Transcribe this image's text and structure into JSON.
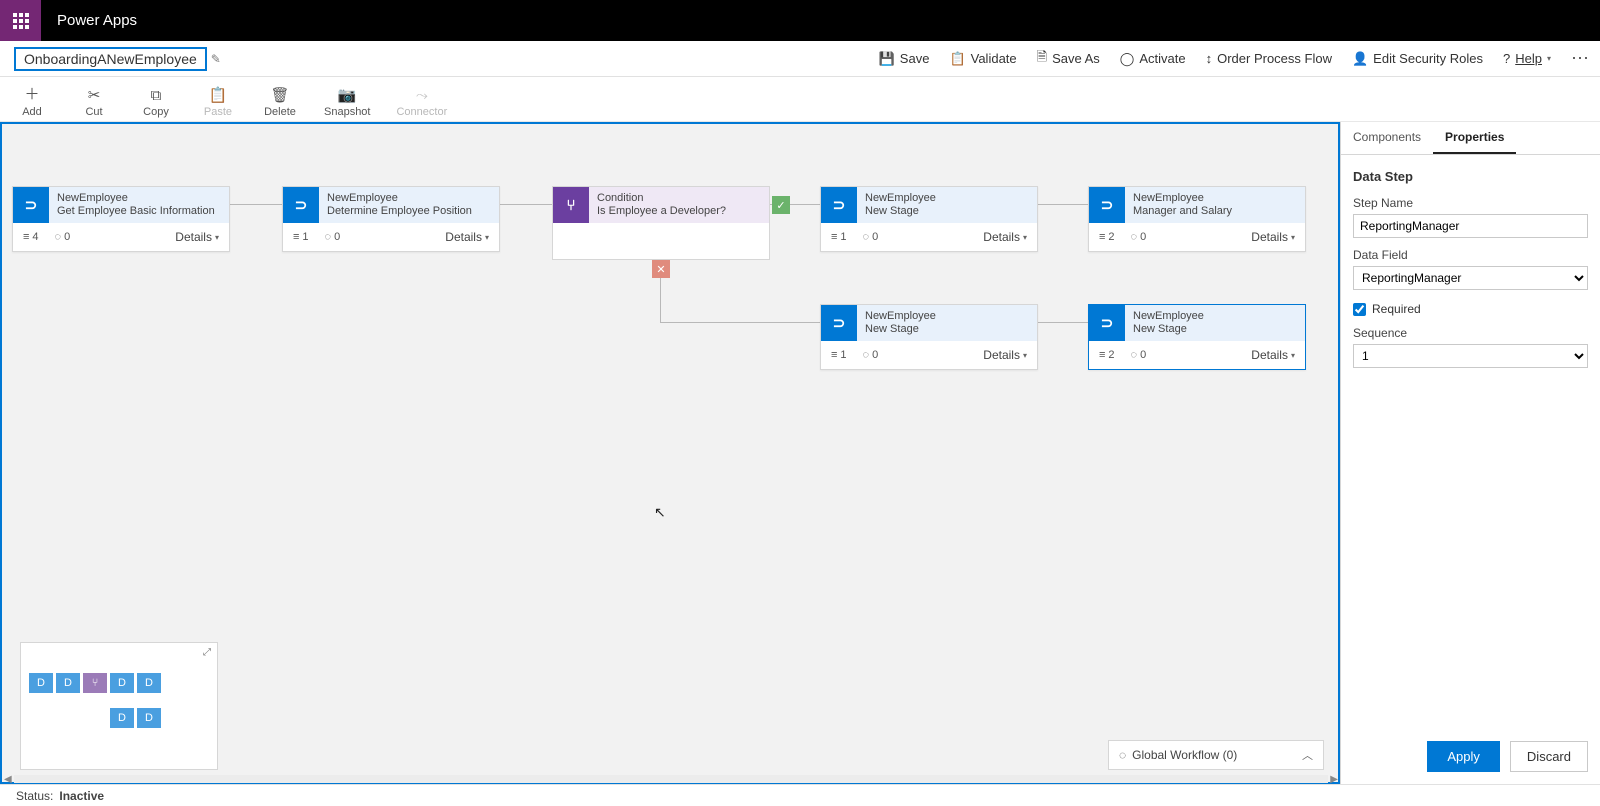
{
  "suite": {
    "title": "Power Apps"
  },
  "formName": "OnboardingANewEmployee",
  "commands": {
    "save": "Save",
    "validate": "Validate",
    "saveAs": "Save As",
    "activate": "Activate",
    "orderProcess": "Order Process Flow",
    "editSecurity": "Edit Security Roles",
    "help": "Help"
  },
  "toolbar": {
    "add": "Add",
    "cut": "Cut",
    "copy": "Copy",
    "paste": "Paste",
    "delete": "Delete",
    "snapshot": "Snapshot",
    "connector": "Connector"
  },
  "nodes": {
    "n1": {
      "title": "NewEmployee",
      "sub": "Get Employee Basic Information",
      "steps": "4",
      "triggers": "0",
      "details": "Details"
    },
    "n2": {
      "title": "NewEmployee",
      "sub": "Determine Employee Position",
      "steps": "1",
      "triggers": "0",
      "details": "Details"
    },
    "cond": {
      "title": "Condition",
      "sub": "Is Employee a Developer?"
    },
    "n3": {
      "title": "NewEmployee",
      "sub": "New Stage",
      "steps": "1",
      "triggers": "0",
      "details": "Details"
    },
    "n4": {
      "title": "NewEmployee",
      "sub": "Manager and Salary",
      "steps": "2",
      "triggers": "0",
      "details": "Details"
    },
    "n5": {
      "title": "NewEmployee",
      "sub": "New Stage",
      "steps": "1",
      "triggers": "0",
      "details": "Details"
    },
    "n6": {
      "title": "NewEmployee",
      "sub": "New Stage",
      "steps": "2",
      "triggers": "0",
      "details": "Details"
    }
  },
  "workflowBar": {
    "label": "Global Workflow (0)"
  },
  "sidePanel": {
    "tabComponents": "Components",
    "tabProperties": "Properties",
    "sectionTitle": "Data Step",
    "stepNameLabel": "Step Name",
    "stepNameValue": "ReportingManager",
    "dataFieldLabel": "Data Field",
    "dataFieldValue": "ReportingManager",
    "requiredLabel": "Required",
    "requiredChecked": true,
    "sequenceLabel": "Sequence",
    "sequenceValue": "1",
    "apply": "Apply",
    "discard": "Discard"
  },
  "status": {
    "label": "Status:",
    "value": "Inactive"
  }
}
